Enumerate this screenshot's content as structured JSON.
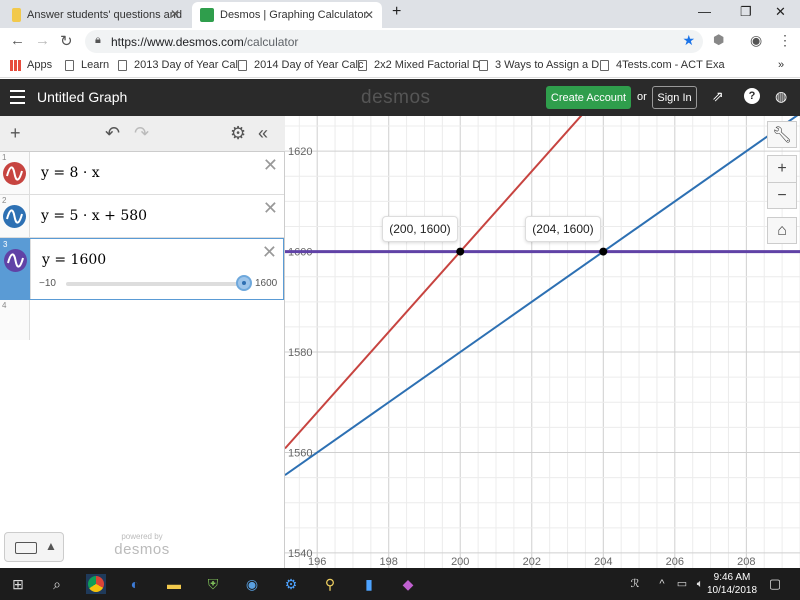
{
  "browser": {
    "tabs": [
      {
        "label": "Answer students' questions and",
        "active": false
      },
      {
        "label": "Desmos | Graphing Calculator",
        "active": true
      }
    ],
    "new_tab": "+",
    "url_main": "https://www.desmos.com",
    "url_path": "/calculator",
    "bookmarks": [
      "Apps",
      "Learn",
      "2013 Day of Year Cal",
      "2014 Day of Year Calc",
      "2x2 Mixed Factorial D",
      "3 Ways to Assign a D",
      "4Tests.com - ACT Exa"
    ],
    "bookmarks_more": "»"
  },
  "header": {
    "title": "Untitled Graph",
    "logo": "desmos",
    "create_account": "Create Account",
    "or": "or",
    "sign_in": "Sign In"
  },
  "expressions": [
    {
      "index": "1",
      "latex": "y = 8 · x",
      "color": "#c74440"
    },
    {
      "index": "2",
      "latex": "y = 5 · x + 580",
      "color": "#2d70b3"
    },
    {
      "index": "3",
      "latex": "y = 1600",
      "color": "#6042a6"
    }
  ],
  "slider": {
    "min": "−10",
    "max": "1600",
    "fraction": 1.0
  },
  "empty_row_index": "4",
  "powered_by": {
    "line1": "powered by",
    "line2": "desmos"
  },
  "graph": {
    "x_range": [
      195.1,
      209.5
    ],
    "y_range": [
      1537,
      1627
    ],
    "x_ticks": [
      "196",
      "198",
      "200",
      "202",
      "204",
      "206",
      "208"
    ],
    "y_ticks": [
      "1540",
      "1560",
      "1580",
      "1600",
      "1620"
    ],
    "lines": [
      {
        "color": "#c74440",
        "slope": 8,
        "intercept": 0
      },
      {
        "color": "#2d70b3",
        "slope": 5,
        "intercept": 580
      },
      {
        "color": "#6042a6",
        "slope": 0,
        "intercept": 1600
      }
    ],
    "points": [
      {
        "x": 200,
        "y": 1600,
        "label": "(200, 1600)"
      },
      {
        "x": 204,
        "y": 1600,
        "label": "(204, 1600)"
      }
    ],
    "controls": [
      "wrench-icon",
      "zoom-in",
      "zoom-out",
      "home-icon"
    ]
  },
  "taskbar": {
    "time": "9:46 AM",
    "date": "10/14/2018"
  }
}
